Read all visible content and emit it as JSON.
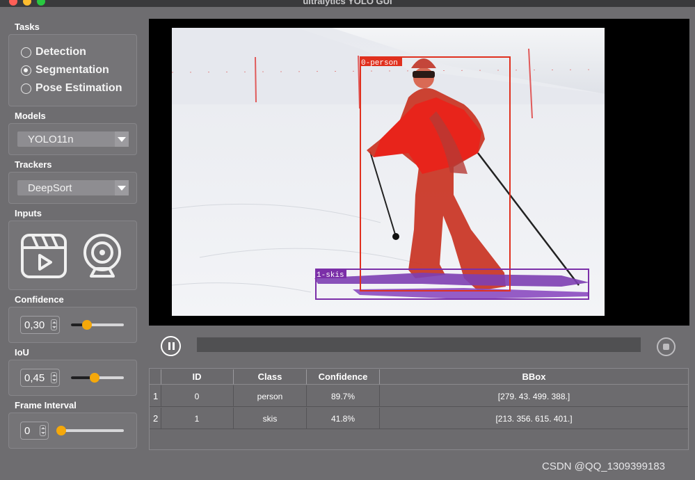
{
  "window": {
    "title": "ultralytics YOLO GUI"
  },
  "tasks": {
    "title": "Tasks",
    "options": [
      {
        "label": "Detection",
        "checked": false
      },
      {
        "label": "Segmentation",
        "checked": true
      },
      {
        "label": "Pose Estimation",
        "checked": false
      }
    ]
  },
  "models": {
    "title": "Models",
    "selected": "YOLO11n"
  },
  "trackers": {
    "title": "Trackers",
    "selected": "DeepSort"
  },
  "inputs": {
    "title": "Inputs",
    "video_icon": "video-file-icon",
    "webcam_icon": "webcam-icon"
  },
  "confidence": {
    "title": "Confidence",
    "value": "0,30",
    "level": 0.3
  },
  "iou": {
    "title": "IoU",
    "value": "0,45",
    "level": 0.45
  },
  "frame_interval": {
    "title": "Frame Interval",
    "value": "0",
    "level": 0.0
  },
  "detections": [
    {
      "label": "0-person",
      "color": "#e0301e"
    },
    {
      "label": "1-skis",
      "color": "#7b2fa8"
    }
  ],
  "playback": {
    "progress": 0
  },
  "table": {
    "headers": [
      "ID",
      "Class",
      "Confidence",
      "BBox"
    ],
    "rows": [
      {
        "num": "1",
        "id": "0",
        "class": "person",
        "confidence": "89.7%",
        "bbox": "[279.  43. 499. 388.]"
      },
      {
        "num": "2",
        "id": "1",
        "class": "skis",
        "confidence": "41.8%",
        "bbox": "[213. 356. 615. 401.]"
      }
    ]
  },
  "watermark": "CSDN @QQ_1309399183"
}
